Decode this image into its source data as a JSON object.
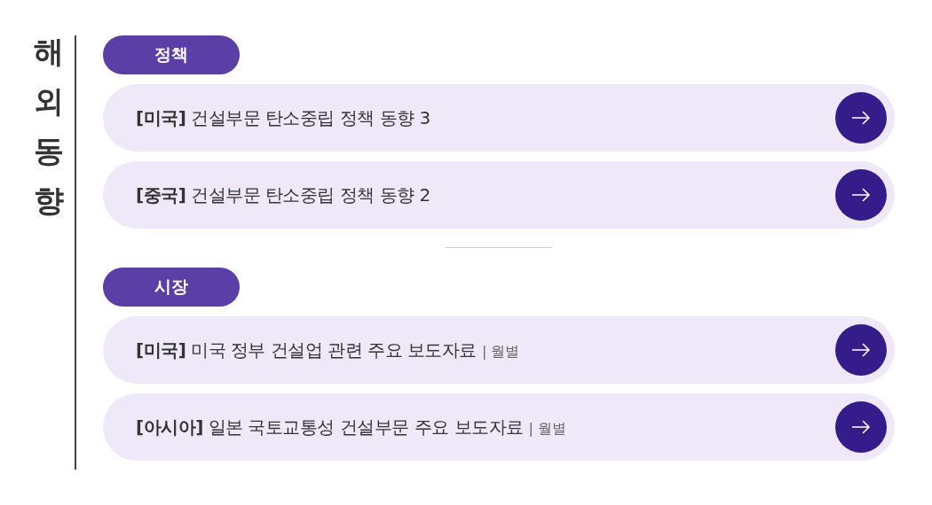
{
  "title": "해외동향",
  "sections": [
    {
      "label": "정책",
      "items": [
        {
          "text": "**[미국]** 건설부문 탄소중립 정책 동향 3"
        },
        {
          "text": "**[중국]** 건설부문 탄소중립 정책 동향 2"
        }
      ]
    },
    {
      "label": "시장",
      "items": [
        {
          "text": "**[미국]** 미국 정부 건설업 관련 주요 보도자료",
          "note": "| 월별"
        },
        {
          "text": "**[아시아]** 일본 국토교통성 건설부문 주요 보도자료",
          "note": "| 월별"
        }
      ]
    }
  ]
}
